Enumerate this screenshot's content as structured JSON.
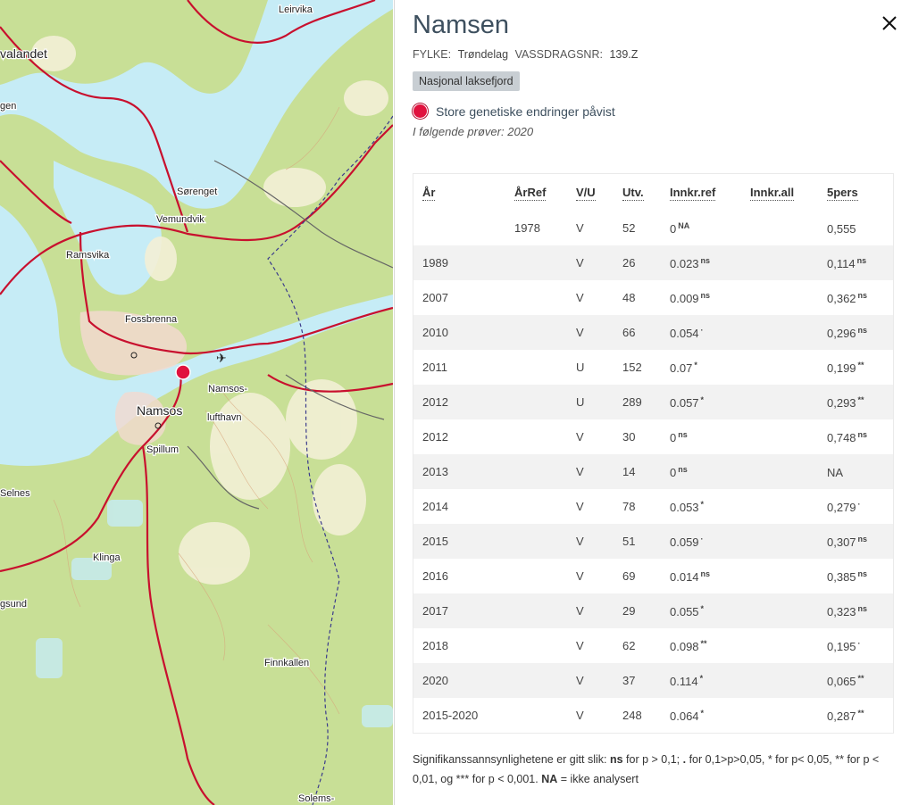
{
  "map": {
    "labels": {
      "leirvika": "Leirvika",
      "valandet": "valandet",
      "gen": "gen",
      "sorenget": "Sørenget",
      "vemundvik": "Vemundvik",
      "ramsvika": "Ramsvika",
      "fossbrenna": "Fossbrenna",
      "namsos_airport_1": "Namsos-",
      "namsos_airport_2": "lufthavn",
      "namsos": "Namsos",
      "spillum": "Spillum",
      "selnes": "Selnes",
      "klinga": "Klinga",
      "gsund": "gsund",
      "finnkallen": "Finnkallen",
      "solems": "Solems-"
    },
    "colors": {
      "water": "#c6ecf6",
      "land": "#c8df96",
      "road": "#c8102e",
      "marker": "#e0123e"
    }
  },
  "panel": {
    "title": "Namsen",
    "close_icon": "close-icon",
    "meta": {
      "fylke_label": "FYLKE:",
      "fylke_value": "Trøndelag",
      "vassdrag_label": "VASSDRAGSNR:",
      "vassdrag_value": "139.Z"
    },
    "badge": "Nasjonal laksefjord",
    "finding": "Store genetiske endringer påvist",
    "samples": "I følgende prøver: 2020",
    "table": {
      "headers": [
        "År",
        "ÅrRef",
        "V/U",
        "Utv.",
        "Innkr.ref",
        "Innkr.all",
        "5pers"
      ],
      "rows": [
        {
          "ar": "",
          "arref": "1978",
          "vu": "V",
          "utv": "52",
          "ref": "0",
          "ref_sig": "NA",
          "all": "",
          "pers": "0,555",
          "pers_sig": ""
        },
        {
          "ar": "1989",
          "arref": "",
          "vu": "V",
          "utv": "26",
          "ref": "0.023",
          "ref_sig": "ns",
          "all": "",
          "pers": "0,114",
          "pers_sig": "ns"
        },
        {
          "ar": "2007",
          "arref": "",
          "vu": "V",
          "utv": "48",
          "ref": "0.009",
          "ref_sig": "ns",
          "all": "",
          "pers": "0,362",
          "pers_sig": "ns"
        },
        {
          "ar": "2010",
          "arref": "",
          "vu": "V",
          "utv": "66",
          "ref": "0.054",
          "ref_sig": "·",
          "all": "",
          "pers": "0,296",
          "pers_sig": "ns"
        },
        {
          "ar": "2011",
          "arref": "",
          "vu": "U",
          "utv": "152",
          "ref": "0.07",
          "ref_sig": "*",
          "all": "",
          "pers": "0,199",
          "pers_sig": "**"
        },
        {
          "ar": "2012",
          "arref": "",
          "vu": "U",
          "utv": "289",
          "ref": "0.057",
          "ref_sig": "*",
          "all": "",
          "pers": "0,293",
          "pers_sig": "**"
        },
        {
          "ar": "2012",
          "arref": "",
          "vu": "V",
          "utv": "30",
          "ref": "0",
          "ref_sig": "ns",
          "all": "",
          "pers": "0,748",
          "pers_sig": "ns"
        },
        {
          "ar": "2013",
          "arref": "",
          "vu": "V",
          "utv": "14",
          "ref": "0",
          "ref_sig": "ns",
          "all": "",
          "pers": "NA",
          "pers_sig": ""
        },
        {
          "ar": "2014",
          "arref": "",
          "vu": "V",
          "utv": "78",
          "ref": "0.053",
          "ref_sig": "*",
          "all": "",
          "pers": "0,279",
          "pers_sig": "·"
        },
        {
          "ar": "2015",
          "arref": "",
          "vu": "V",
          "utv": "51",
          "ref": "0.059",
          "ref_sig": "·",
          "all": "",
          "pers": "0,307",
          "pers_sig": "ns"
        },
        {
          "ar": "2016",
          "arref": "",
          "vu": "V",
          "utv": "69",
          "ref": "0.014",
          "ref_sig": "ns",
          "all": "",
          "pers": "0,385",
          "pers_sig": "ns"
        },
        {
          "ar": "2017",
          "arref": "",
          "vu": "V",
          "utv": "29",
          "ref": "0.055",
          "ref_sig": "*",
          "all": "",
          "pers": "0,323",
          "pers_sig": "ns"
        },
        {
          "ar": "2018",
          "arref": "",
          "vu": "V",
          "utv": "62",
          "ref": "0.098",
          "ref_sig": "**",
          "all": "",
          "pers": "0,195",
          "pers_sig": "·"
        },
        {
          "ar": "2020",
          "arref": "",
          "vu": "V",
          "utv": "37",
          "ref": "0.114",
          "ref_sig": "*",
          "all": "",
          "pers": "0,065",
          "pers_sig": "**"
        },
        {
          "ar": "2015-2020",
          "arref": "",
          "vu": "V",
          "utv": "248",
          "ref": "0.064",
          "ref_sig": "*",
          "all": "",
          "pers": "0,287",
          "pers_sig": "**"
        }
      ]
    },
    "footnote": {
      "t1": "Signifikanssannsynlighetene er gitt slik: ",
      "ns": "ns",
      "t2": " for p > 0,1; ",
      "dot": ".",
      "t3": " for 0,1>p>0,05, * for p< 0,05, ** for p < 0,01, og *** for p < 0,001. ",
      "na": "NA",
      "t4": " = ikke analysert"
    }
  }
}
